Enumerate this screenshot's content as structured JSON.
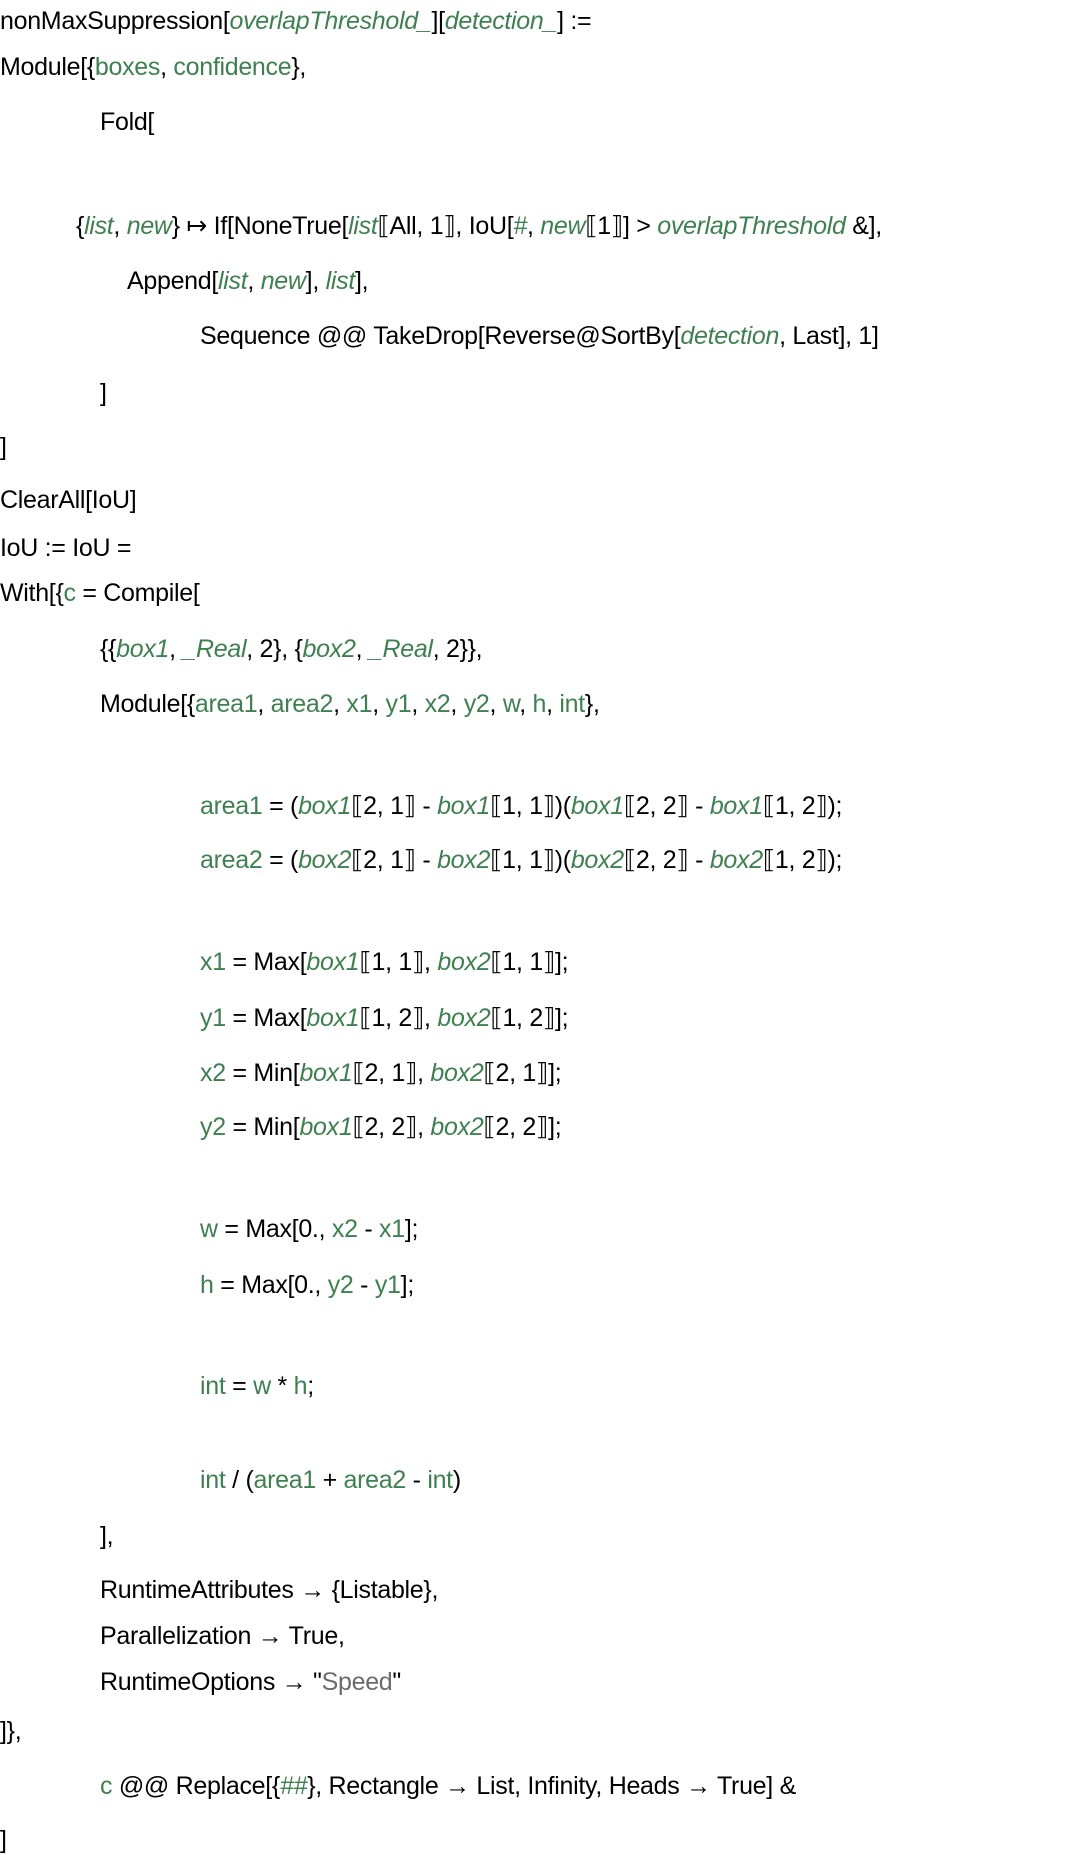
{
  "colors": {
    "symbol": "#000000",
    "local_variable": "#3f8050",
    "pattern_variable": "#3f8050",
    "string": "#6b6b6b"
  },
  "lines": [
    {
      "tokens": [
        [
          "nonMaxSuppression",
          "k"
        ],
        [
          "[",
          "k"
        ],
        [
          "overlapThreshold_",
          "i"
        ],
        [
          "][",
          "k"
        ],
        [
          "detection_",
          "i"
        ],
        [
          "] :=",
          "k"
        ]
      ]
    },
    {
      "tokens": [
        [
          "Module[{",
          "k"
        ],
        [
          "boxes",
          "v"
        ],
        [
          ", ",
          "k"
        ],
        [
          "confidence",
          "v"
        ],
        [
          "},",
          "k"
        ]
      ]
    },
    {
      "tokens": [
        [
          "Fold[",
          "k"
        ]
      ]
    },
    {
      "tokens": [
        [
          "{",
          "k"
        ],
        [
          "list",
          "i"
        ],
        [
          ", ",
          "k"
        ],
        [
          "new",
          "i"
        ],
        [
          "} ↦ If[NoneTrue[",
          "k"
        ],
        [
          "list",
          "i"
        ],
        [
          "⟦All, 1⟧, IoU[",
          "k"
        ],
        [
          "#",
          "i"
        ],
        [
          ", ",
          "k"
        ],
        [
          "new",
          "i"
        ],
        [
          "⟦1⟧] > ",
          "k"
        ],
        [
          "overlapThreshold",
          "i"
        ],
        [
          " &],",
          "k"
        ]
      ]
    },
    {
      "tokens": [
        [
          "Append[",
          "k"
        ],
        [
          "list",
          "i"
        ],
        [
          ", ",
          "k"
        ],
        [
          "new",
          "i"
        ],
        [
          "], ",
          "k"
        ],
        [
          "list",
          "i"
        ],
        [
          "],",
          "k"
        ]
      ]
    },
    {
      "tokens": [
        [
          "Sequence @@ TakeDrop[Reverse@SortBy[",
          "k"
        ],
        [
          "detection",
          "i"
        ],
        [
          ", Last], 1]",
          "k"
        ]
      ]
    },
    {
      "tokens": [
        [
          "]",
          "k"
        ]
      ]
    },
    {
      "tokens": [
        [
          "]",
          "k"
        ]
      ]
    },
    {
      "tokens": [
        [
          "ClearAll[IoU]",
          "k"
        ]
      ]
    },
    {
      "tokens": [
        [
          "IoU := IoU =",
          "k"
        ]
      ]
    },
    {
      "tokens": [
        [
          "With[{",
          "k"
        ],
        [
          "c",
          "v"
        ],
        [
          " = Compile[",
          "k"
        ]
      ]
    },
    {
      "tokens": [
        [
          "{{",
          "k"
        ],
        [
          "box1",
          "i"
        ],
        [
          ", ",
          "k"
        ],
        [
          "_Real",
          "i"
        ],
        [
          ", 2}, {",
          "k"
        ],
        [
          "box2",
          "i"
        ],
        [
          ", ",
          "k"
        ],
        [
          "_Real",
          "i"
        ],
        [
          ", 2}},",
          "k"
        ]
      ]
    },
    {
      "tokens": [
        [
          "Module[{",
          "k"
        ],
        [
          "area1",
          "v"
        ],
        [
          ", ",
          "k"
        ],
        [
          "area2",
          "v"
        ],
        [
          ", ",
          "k"
        ],
        [
          "x1",
          "v"
        ],
        [
          ", ",
          "k"
        ],
        [
          "y1",
          "v"
        ],
        [
          ", ",
          "k"
        ],
        [
          "x2",
          "v"
        ],
        [
          ", ",
          "k"
        ],
        [
          "y2",
          "v"
        ],
        [
          ", ",
          "k"
        ],
        [
          "w",
          "v"
        ],
        [
          ", ",
          "k"
        ],
        [
          "h",
          "v"
        ],
        [
          ", ",
          "k"
        ],
        [
          "int",
          "v"
        ],
        [
          "},",
          "k"
        ]
      ]
    },
    {
      "tokens": [
        [
          "area1",
          "v"
        ],
        [
          " = (",
          "k"
        ],
        [
          "box1",
          "i"
        ],
        [
          "⟦2, 1⟧ - ",
          "k"
        ],
        [
          "box1",
          "i"
        ],
        [
          "⟦1, 1⟧)(",
          "k"
        ],
        [
          "box1",
          "i"
        ],
        [
          "⟦2, 2⟧ - ",
          "k"
        ],
        [
          "box1",
          "i"
        ],
        [
          "⟦1, 2⟧);",
          "k"
        ]
      ]
    },
    {
      "tokens": [
        [
          "area2",
          "v"
        ],
        [
          " = (",
          "k"
        ],
        [
          "box2",
          "i"
        ],
        [
          "⟦2, 1⟧ - ",
          "k"
        ],
        [
          "box2",
          "i"
        ],
        [
          "⟦1, 1⟧)(",
          "k"
        ],
        [
          "box2",
          "i"
        ],
        [
          "⟦2, 2⟧ - ",
          "k"
        ],
        [
          "box2",
          "i"
        ],
        [
          "⟦1, 2⟧);",
          "k"
        ]
      ]
    },
    {
      "tokens": [
        [
          "x1",
          "v"
        ],
        [
          " = Max[",
          "k"
        ],
        [
          "box1",
          "i"
        ],
        [
          "⟦1, 1⟧, ",
          "k"
        ],
        [
          "box2",
          "i"
        ],
        [
          "⟦1, 1⟧];",
          "k"
        ]
      ]
    },
    {
      "tokens": [
        [
          "y1",
          "v"
        ],
        [
          " = Max[",
          "k"
        ],
        [
          "box1",
          "i"
        ],
        [
          "⟦1, 2⟧, ",
          "k"
        ],
        [
          "box2",
          "i"
        ],
        [
          "⟦1, 2⟧];",
          "k"
        ]
      ]
    },
    {
      "tokens": [
        [
          "x2",
          "v"
        ],
        [
          " = Min[",
          "k"
        ],
        [
          "box1",
          "i"
        ],
        [
          "⟦2, 1⟧, ",
          "k"
        ],
        [
          "box2",
          "i"
        ],
        [
          "⟦2, 1⟧];",
          "k"
        ]
      ]
    },
    {
      "tokens": [
        [
          "y2",
          "v"
        ],
        [
          " = Min[",
          "k"
        ],
        [
          "box1",
          "i"
        ],
        [
          "⟦2, 2⟧, ",
          "k"
        ],
        [
          "box2",
          "i"
        ],
        [
          "⟦2, 2⟧];",
          "k"
        ]
      ]
    },
    {
      "tokens": [
        [
          "w",
          "v"
        ],
        [
          " = Max[0., ",
          "k"
        ],
        [
          "x2",
          "v"
        ],
        [
          " - ",
          "k"
        ],
        [
          "x1",
          "v"
        ],
        [
          "];",
          "k"
        ]
      ]
    },
    {
      "tokens": [
        [
          "h",
          "v"
        ],
        [
          " = Max[0., ",
          "k"
        ],
        [
          "y2",
          "v"
        ],
        [
          " - ",
          "k"
        ],
        [
          "y1",
          "v"
        ],
        [
          "];",
          "k"
        ]
      ]
    },
    {
      "tokens": [
        [
          "int",
          "v"
        ],
        [
          " = ",
          "k"
        ],
        [
          "w",
          "v"
        ],
        [
          " * ",
          "k"
        ],
        [
          "h",
          "v"
        ],
        [
          ";",
          "k"
        ]
      ]
    },
    {
      "tokens": [
        [
          "int",
          "v"
        ],
        [
          " / (",
          "k"
        ],
        [
          "area1",
          "v"
        ],
        [
          " + ",
          "k"
        ],
        [
          "area2",
          "v"
        ],
        [
          " - ",
          "k"
        ],
        [
          "int",
          "v"
        ],
        [
          ")",
          "k"
        ]
      ]
    },
    {
      "tokens": [
        [
          "],",
          "k"
        ]
      ]
    },
    {
      "tokens": [
        [
          "RuntimeAttributes → {Listable},",
          "k"
        ]
      ]
    },
    {
      "tokens": [
        [
          "Parallelization → True,",
          "k"
        ]
      ]
    },
    {
      "tokens": [
        [
          "RuntimeOptions → \"",
          "k"
        ],
        [
          "Speed",
          "s"
        ],
        [
          "\"",
          "k"
        ]
      ]
    },
    {
      "tokens": [
        [
          "]},",
          "k"
        ]
      ]
    },
    {
      "tokens": [
        [
          "c",
          "v"
        ],
        [
          " @@ Replace[{",
          "k"
        ],
        [
          "##",
          "i"
        ],
        [
          "}, Rectangle → List, Infinity, Heads → True] &",
          "k"
        ]
      ]
    },
    {
      "tokens": [
        [
          "]",
          "k"
        ]
      ]
    }
  ]
}
